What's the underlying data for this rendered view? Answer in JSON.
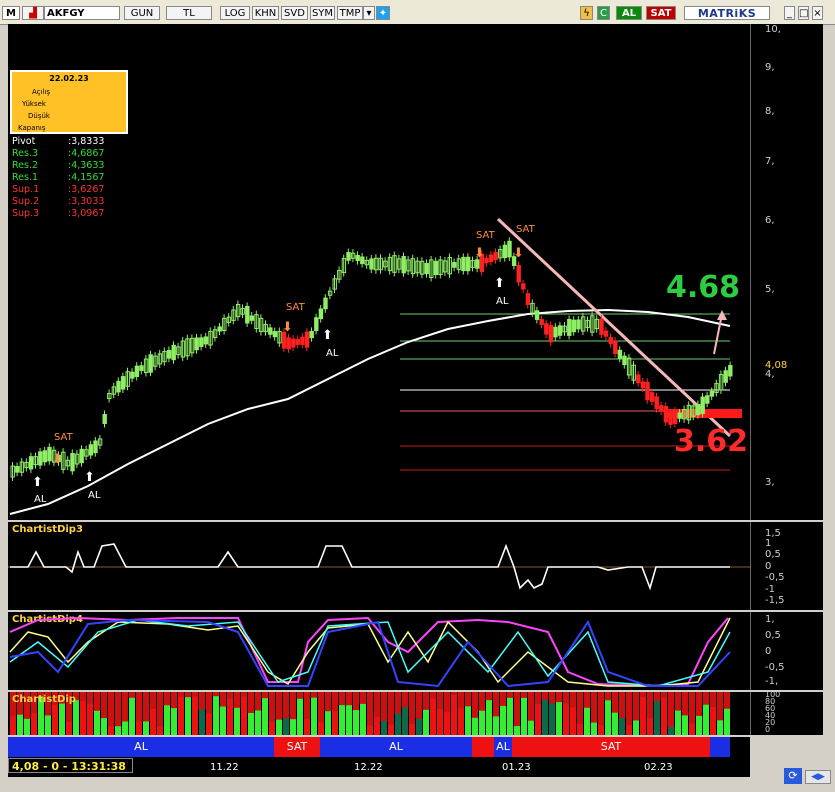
{
  "toolbar": {
    "menu": "M",
    "symbol": "AKFGY",
    "gun": "GUN",
    "tl": "TL",
    "log": "LOG",
    "khn": "KHN",
    "svd": "SVD",
    "sym": "SYM",
    "tmp": "TMP",
    "al": "AL",
    "sat": "SAT",
    "brand": "MATRiKS"
  },
  "info": {
    "date": "22.02.23",
    "rows": [
      "Açılış",
      "Yüksek",
      "Düşük",
      "Kapanış"
    ]
  },
  "pivots": {
    "pivot_label": "Pivot",
    "pivot_value": ":3,8333",
    "res3_label": "Res.3",
    "res3_value": ":4,6867",
    "res2_label": "Res.2",
    "res2_value": ":4,3633",
    "res1_label": "Res.1",
    "res1_value": ":4,1567",
    "sup1_label": "Sup.1",
    "sup1_value": ":3,6267",
    "sup2_label": "Sup.2",
    "sup2_value": ":3,3033",
    "sup3_label": "Sup.3",
    "sup3_value": ":3,0967"
  },
  "price_axis": {
    "ticks": [
      "10,",
      "9,",
      "8,",
      "7,",
      "6,",
      "5,",
      "4,",
      "3,"
    ],
    "last_price": "4,08"
  },
  "annotations": {
    "target_up": "4.68",
    "target_down": "3.62",
    "al": "AL",
    "sat": "SAT"
  },
  "indicators": {
    "dip3": {
      "name": "ChartistDip3",
      "ticks": [
        "1,5",
        "1",
        "0,5",
        "0",
        "-0,5",
        "-1",
        "-1,5"
      ]
    },
    "dip4": {
      "name": "ChartistDip4",
      "ticks": [
        "1,",
        "0,5",
        "0",
        "-0,5",
        "-1,"
      ]
    },
    "dip5": {
      "name": "ChartistDip",
      "ticks": [
        "100",
        "80",
        "60",
        "40",
        "20",
        "0"
      ]
    }
  },
  "signals": [
    {
      "label": "AL",
      "color": "#1a2ee6"
    },
    {
      "label": "SAT",
      "color": "#ee1111"
    },
    {
      "label": "AL",
      "color": "#1a2ee6"
    },
    {
      "label": "",
      "color": "#ee1111"
    },
    {
      "label": "AL",
      "color": "#1a2ee6"
    },
    {
      "label": "SAT",
      "color": "#ee1111"
    },
    {
      "label": "",
      "color": "#1a2ee6"
    }
  ],
  "dates": [
    "11.22",
    "12.22",
    "01.23",
    "02.23"
  ],
  "status": "4,08 - 0 - 13:31:38",
  "colors": {
    "up": "#90ee66",
    "down": "#ff2020",
    "ma": "#ffffff",
    "target_up": "#2ecc40",
    "target_down": "#ff2a2a"
  }
}
